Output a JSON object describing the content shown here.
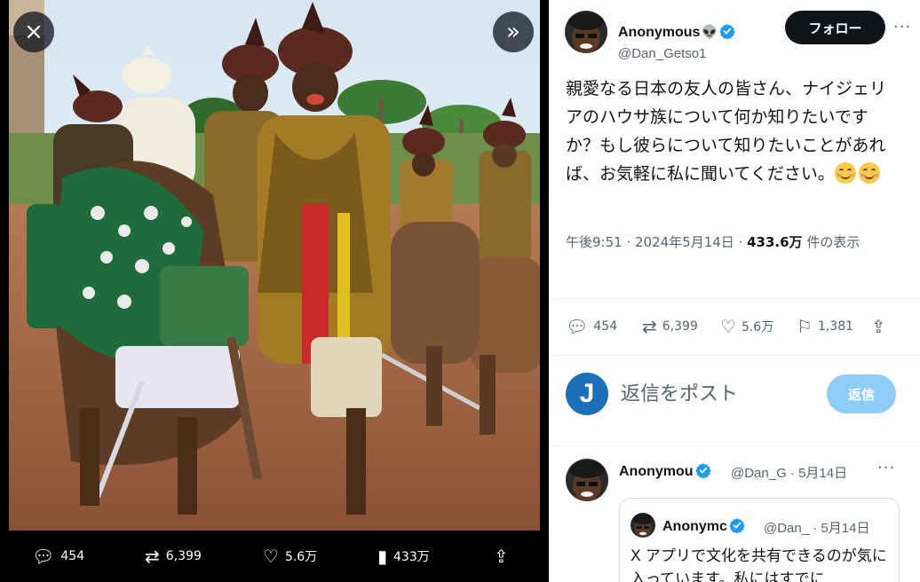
{
  "media": {
    "close_icon": "×",
    "expand_icon": "»",
    "actions": {
      "replies": "454",
      "retweets": "6,399",
      "likes": "5.6万",
      "views": "433万"
    }
  },
  "tweet": {
    "author_name": "Anonymous",
    "author_emoji": "👽",
    "author_handle": "@Dan_Getso1",
    "follow_label": "フォロー",
    "more_label": "···",
    "text": "親愛なる日本の友人の皆さん、ナイジェリアのハウサ族について何か知りたいですか？もし彼らについて知りたいことがあれば、お気軽に私に聞いてください。",
    "timestamp": "午後9:51 · 2024年5月14日 · ",
    "view_count": "433.6万",
    "view_suffix": " 件の表示",
    "stats": {
      "replies": "454",
      "retweets": "6,399",
      "likes": "5.6万",
      "bookmarks": "1,381"
    }
  },
  "reply_composer": {
    "avatar_letter": "J",
    "placeholder": "返信をポスト",
    "button_label": "返信"
  },
  "reply": {
    "author_name": "Anonymou",
    "meta": "@Dan_G · 5月14日",
    "more_label": "···",
    "quote": {
      "author_name": "Anonymc",
      "meta": "@Dan_ · 5月14日",
      "text": "X アプリで文化を共有できるのが気に入っています。私にはすでに"
    }
  },
  "colors": {
    "accent": "#1d9bf0",
    "reply_button": "#8ecdf8",
    "follow_button": "#0f1419",
    "muted_text": "#536471"
  }
}
